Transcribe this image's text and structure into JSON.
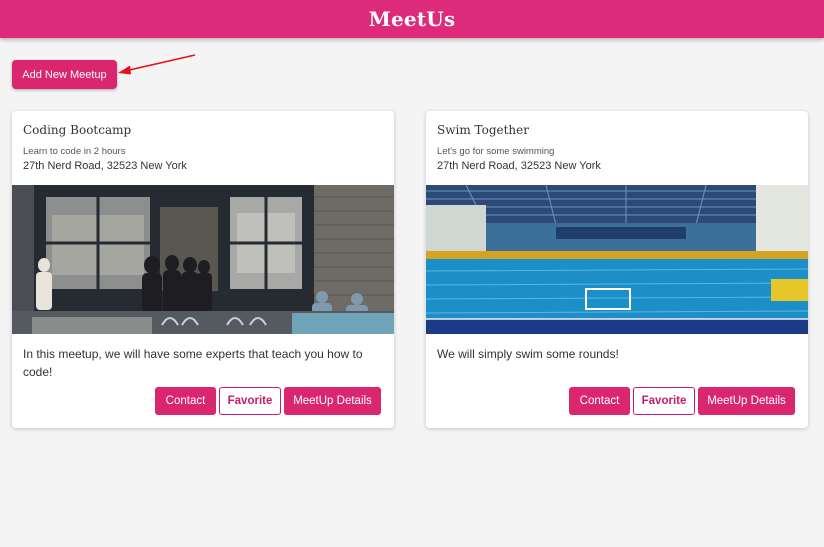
{
  "header": {
    "brand": "MeetUs"
  },
  "toolbar": {
    "add_label": "Add New Meetup"
  },
  "meetups": [
    {
      "title": "Coding Bootcamp",
      "subtitle": "Learn to code in 2 hours",
      "address": "27th Nerd Road, 32523 New York",
      "description": "In this meetup, we will have some experts that teach you how to code!",
      "contact_label": "Contact",
      "favorite_label": "Favorite",
      "details_label": "MeetUp Details"
    },
    {
      "title": "Swim Together",
      "subtitle": "Let's go for some swimming",
      "address": "27th Nerd Road, 32523 New York",
      "description": "We will simply swim some rounds!",
      "contact_label": "Contact",
      "favorite_label": "Favorite",
      "details_label": "MeetUp Details"
    }
  ],
  "colors": {
    "accent": "#de2a7a",
    "button": "#d9266f",
    "annotation_arrow": "#e8101c"
  }
}
